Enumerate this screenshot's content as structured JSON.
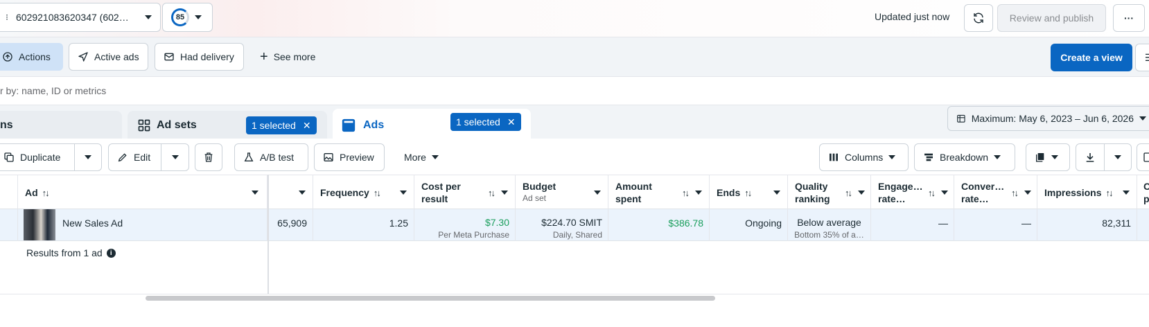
{
  "topbar": {
    "account_label": "602921083620347 (602…",
    "score": "85",
    "updated_text": "Updated just now",
    "review_publish_label": "Review and publish",
    "more_label": "···"
  },
  "views": {
    "actions_label": "Actions",
    "active_ads_label": "Active ads",
    "had_delivery_label": "Had delivery",
    "see_more_label": "See more",
    "create_view_label": "Create a view"
  },
  "filter": {
    "placeholder": "r by: name, ID or metrics"
  },
  "tabs": {
    "campaigns_label": "ns",
    "adsets_label": "Ad sets",
    "adsets_selected": "1 selected",
    "ads_label": "Ads",
    "ads_selected": "1 selected",
    "date_range": "Maximum: May 6, 2023 – Jun 6, 2026"
  },
  "toolbar": {
    "duplicate_label": "Duplicate",
    "edit_label": "Edit",
    "ab_test_label": "A/B test",
    "preview_label": "Preview",
    "more_label": "More",
    "columns_label": "Columns",
    "breakdown_label": "Breakdown"
  },
  "table": {
    "headers": {
      "ad": "Ad",
      "frequency": "Frequency",
      "cost_per_result_1": "Cost per",
      "cost_per_result_2": "result",
      "budget": "Budget",
      "budget_sub": "Ad set",
      "amount_spent_1": "Amount",
      "amount_spent_2": "spent",
      "ends": "Ends",
      "quality_1": "Quality",
      "quality_2": "ranking",
      "engage_1": "Engage…",
      "engage_2": "rate…",
      "conver_1": "Conver…",
      "conver_2": "rate…",
      "impressions": "Impressions",
      "cut_1": "C",
      "cut_2": "p"
    },
    "row": {
      "ad_name": "New Sales Ad",
      "reach": "65,909",
      "frequency": "1.25",
      "cost_per_result": "$7.30",
      "cost_per_result_sub": "Per Meta Purchase",
      "budget": "$224.70 SMIT",
      "budget_sub": "Daily, Shared",
      "amount_spent": "$386.78",
      "ends": "Ongoing",
      "quality": "Below average",
      "quality_sub": "Bottom 35% of a…",
      "engage": "—",
      "conver": "—",
      "impressions": "82,311"
    },
    "results_text": "Results from 1 ad"
  },
  "colors": {
    "primary": "#0a66c2",
    "positive": "#1a9e5c",
    "selected_row": "#ebf3fc"
  }
}
